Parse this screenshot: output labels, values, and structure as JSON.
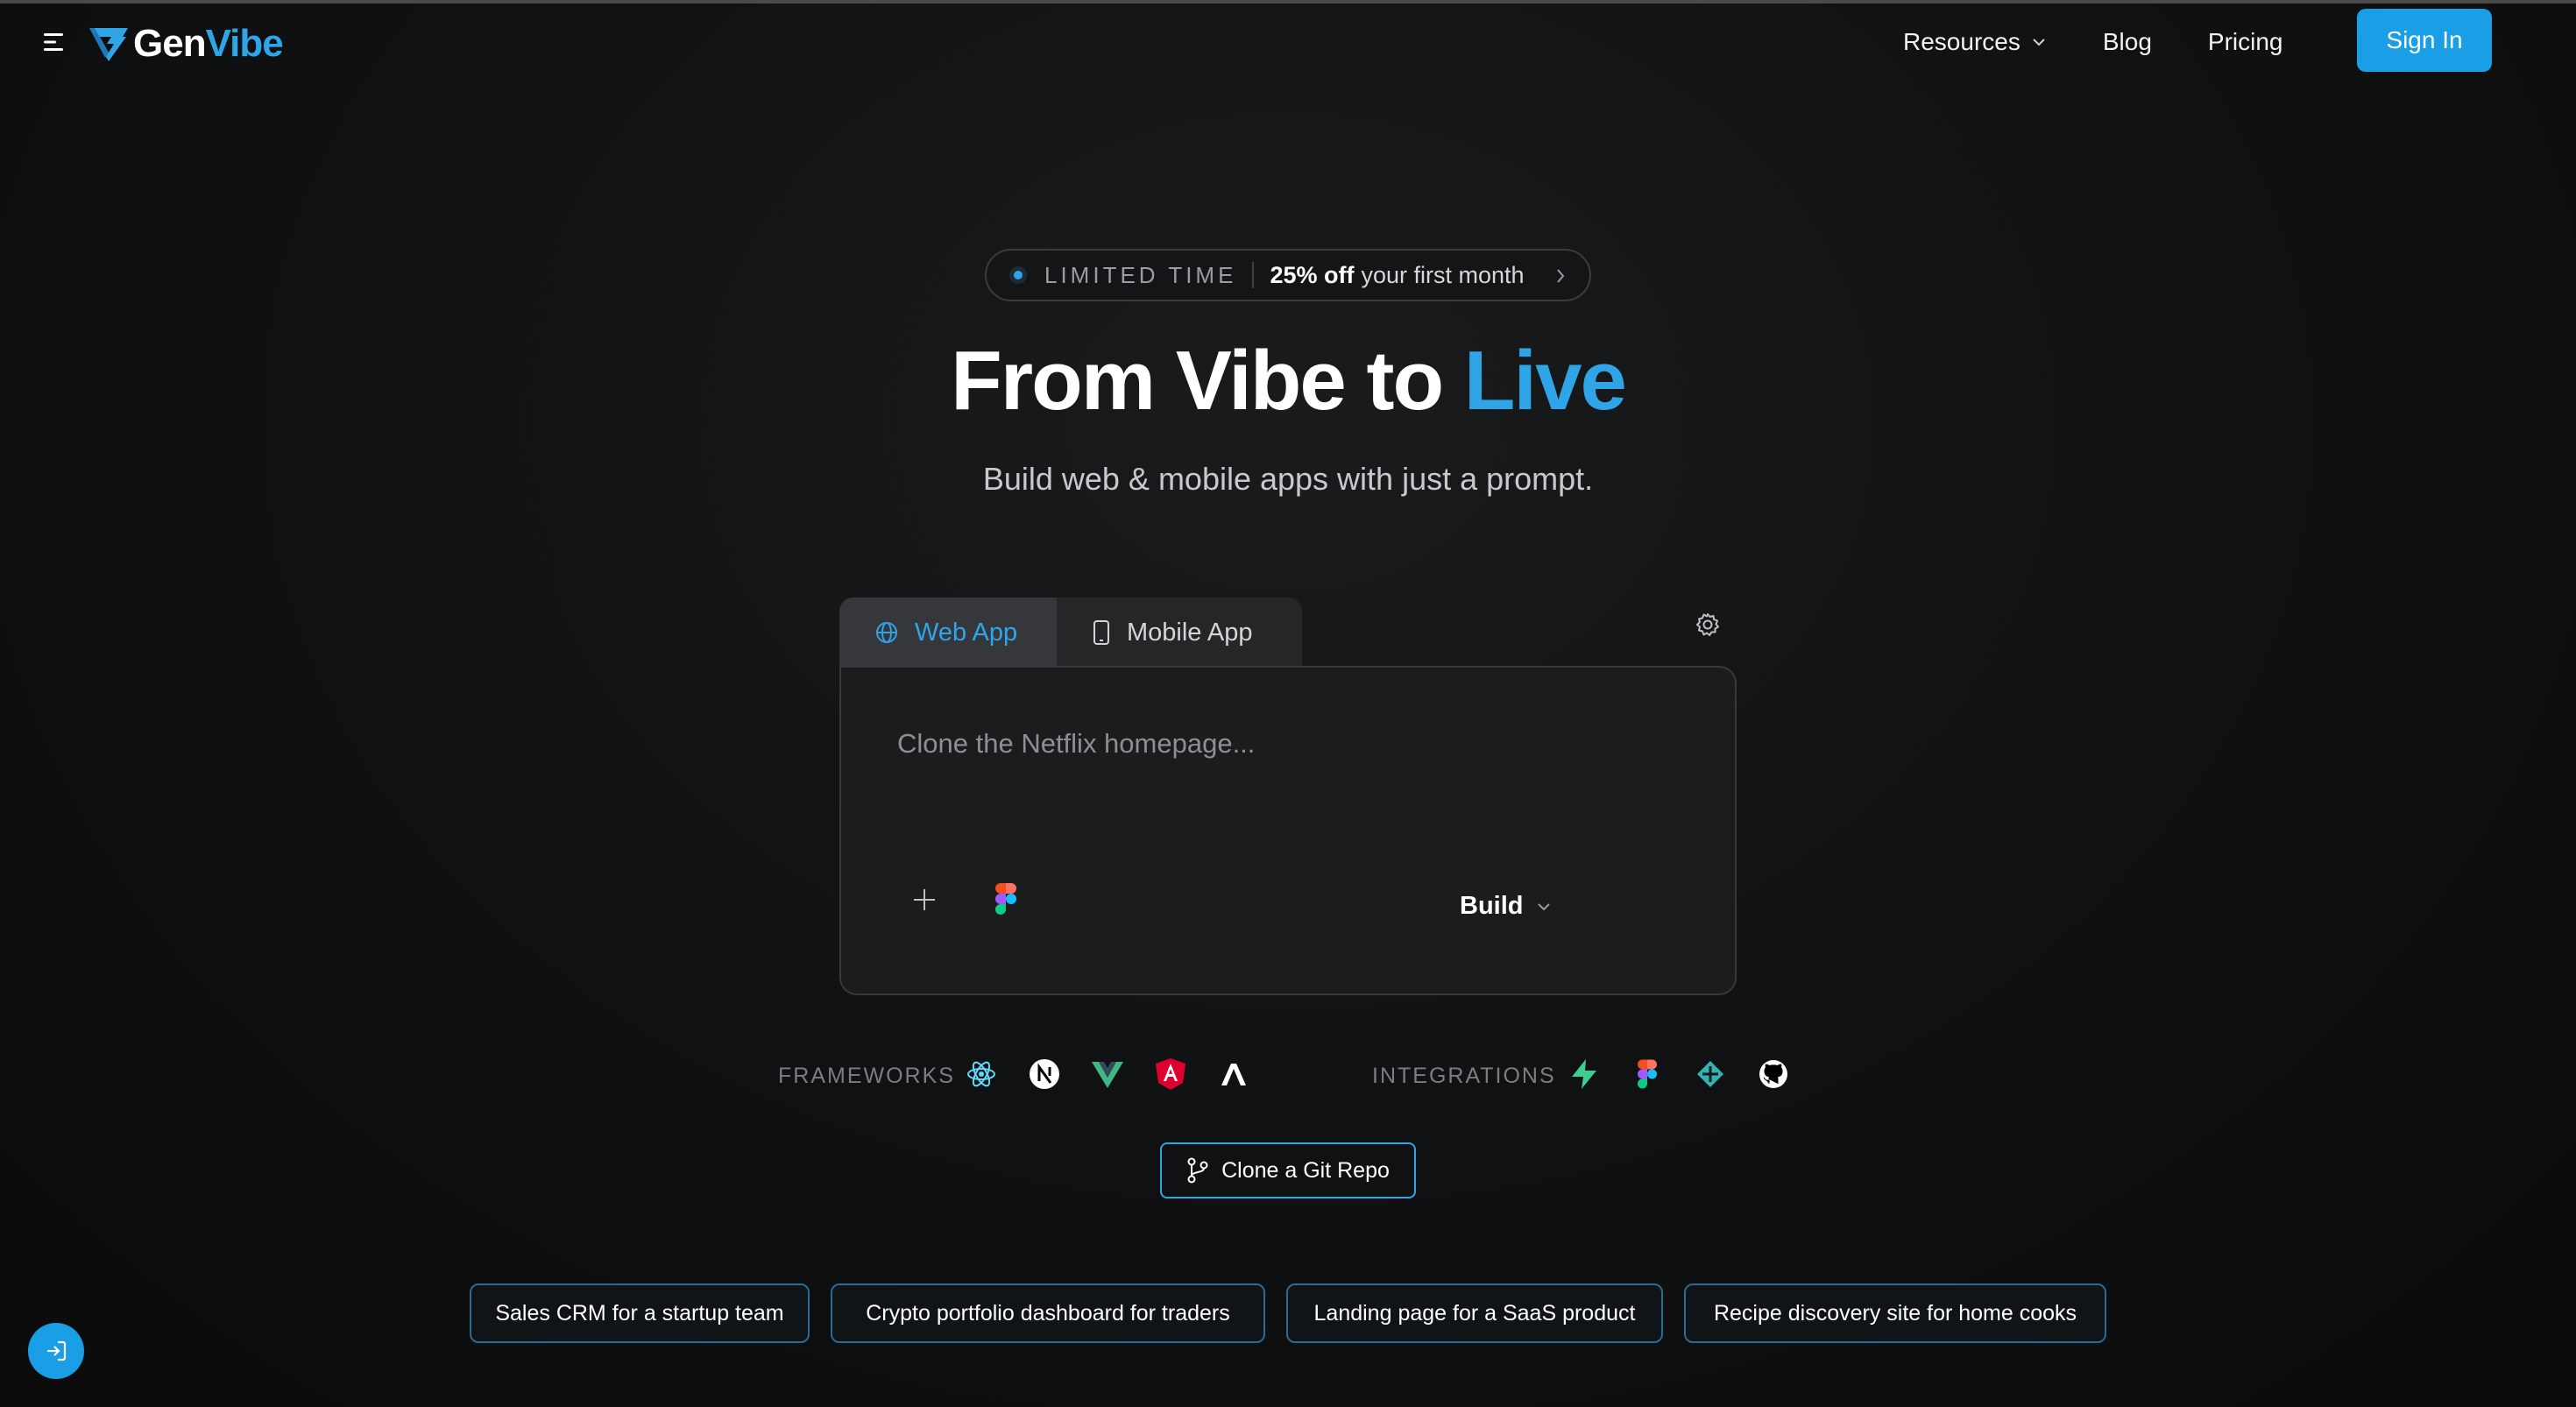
{
  "header": {
    "logo": {
      "part1": "Gen",
      "part2": "Vibe"
    },
    "nav": [
      {
        "label": "Resources",
        "has_dropdown": true
      },
      {
        "label": "Blog"
      },
      {
        "label": "Pricing"
      }
    ],
    "signin_label": "Sign In"
  },
  "promo": {
    "tag": "LIMITED TIME",
    "bold": "25% off",
    "rest": "your first month"
  },
  "hero": {
    "title_main": "From Vibe to ",
    "title_accent": "Live",
    "subtitle": "Build web & mobile apps with just a prompt."
  },
  "prompt": {
    "tabs": [
      {
        "label": "Web App",
        "icon": "globe-icon",
        "active": true
      },
      {
        "label": "Mobile App",
        "icon": "phone-icon",
        "active": false
      }
    ],
    "placeholder": "Clone the Netflix homepage...",
    "build_label": "Build"
  },
  "frameworks": {
    "label": "FRAMEWORKS",
    "icons": [
      "react-icon",
      "nextjs-icon",
      "vue-icon",
      "angular-icon",
      "astro-icon"
    ]
  },
  "integrations": {
    "label": "INTEGRATIONS",
    "icons": [
      "supabase-icon",
      "figma-icon",
      "netlify-icon",
      "github-icon"
    ]
  },
  "clone_repo_label": "Clone a Git Repo",
  "suggestions": [
    "Sales CRM for a startup team",
    "Crypto portfolio dashboard for traders",
    "Landing page for a SaaS product",
    "Recipe discovery site for home cooks"
  ],
  "colors": {
    "accent": "#2fa4e7",
    "button": "#1a9ee6",
    "background": "#111213"
  }
}
